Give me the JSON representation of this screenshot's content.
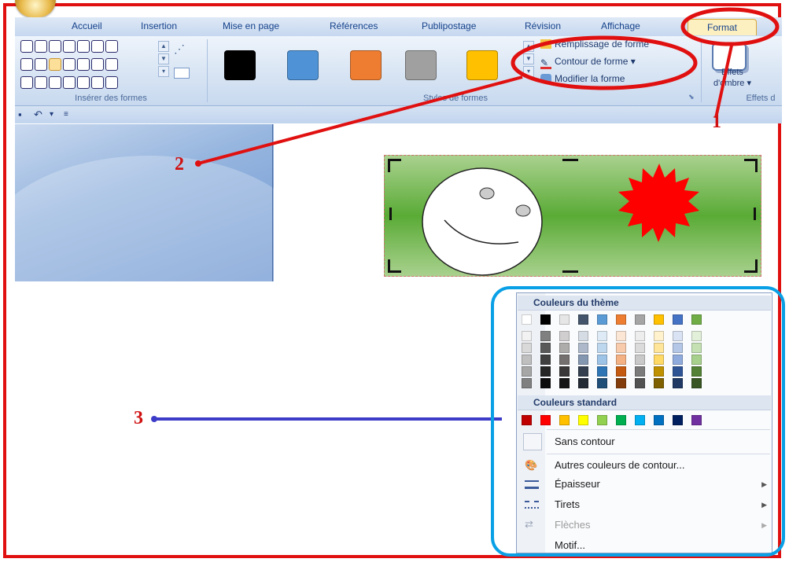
{
  "tabs": [
    "Accueil",
    "Insertion",
    "Mise en page",
    "Références",
    "Publipostage",
    "Révision",
    "Affichage",
    "Format"
  ],
  "active_tab": "Format",
  "ribbon": {
    "group_insert_shapes": "Insérer des formes",
    "group_shape_styles": "Styles de formes",
    "group_shadow_effects": "Effets d",
    "cmd_fill": "Remplissage de forme",
    "cmd_outline": "Contour de forme",
    "cmd_modify": "Modifier la forme",
    "shadow_effects_line1": "Effets",
    "shadow_effects_line2": "d'ombre",
    "style_colors": [
      "#000000",
      "#4f93d6",
      "#ee7d31",
      "#a0a0a0",
      "#ffc000"
    ]
  },
  "callouts": {
    "one": "1",
    "two": "2",
    "three": "3"
  },
  "menu": {
    "theme_colors_header": "Couleurs du thème",
    "standard_colors_header": "Couleurs standard",
    "theme_top_row": [
      "#ffffff",
      "#000000",
      "#e7e6e6",
      "#44546a",
      "#5b9bd5",
      "#ed7d31",
      "#a5a5a5",
      "#ffc000",
      "#4472c4",
      "#70ad47"
    ],
    "theme_shades": [
      [
        "#f2f2f2",
        "#d9d9d9",
        "#bfbfbf",
        "#a6a6a6",
        "#808080"
      ],
      [
        "#808080",
        "#595959",
        "#404040",
        "#262626",
        "#0d0d0d"
      ],
      [
        "#d0cece",
        "#aeabab",
        "#757070",
        "#3a3838",
        "#171616"
      ],
      [
        "#d6dce4",
        "#adb9ca",
        "#8497b0",
        "#333f4f",
        "#222a35"
      ],
      [
        "#deebf6",
        "#bdd7ee",
        "#9dc3e6",
        "#2e75b5",
        "#1f4e79"
      ],
      [
        "#fbe5d5",
        "#f7cbac",
        "#f4b183",
        "#c55a11",
        "#833c0b"
      ],
      [
        "#ededed",
        "#dbdbdb",
        "#c9c9c9",
        "#7b7b7b",
        "#525252"
      ],
      [
        "#fff2cc",
        "#fee599",
        "#ffd965",
        "#bf9000",
        "#7f6000"
      ],
      [
        "#dae3f3",
        "#b4c7e7",
        "#8faadc",
        "#2f5496",
        "#1f3864"
      ],
      [
        "#e2efd9",
        "#c5e0b3",
        "#a8d08d",
        "#538135",
        "#375623"
      ]
    ],
    "standard_colors": [
      "#c00000",
      "#ff0000",
      "#ffc000",
      "#ffff00",
      "#92d050",
      "#00b050",
      "#00b0f0",
      "#0070c0",
      "#002060",
      "#7030a0"
    ],
    "items": {
      "no_outline": "Sans contour",
      "more_colors": "Autres couleurs de contour...",
      "weight": "Épaisseur",
      "dashes": "Tirets",
      "arrows": "Flèches",
      "pattern": "Motif..."
    }
  },
  "colors": {
    "annotation_red": "#e01010",
    "annotation_blue": "#3c3cc8",
    "annotation_cyan": "#0aa0e6"
  }
}
